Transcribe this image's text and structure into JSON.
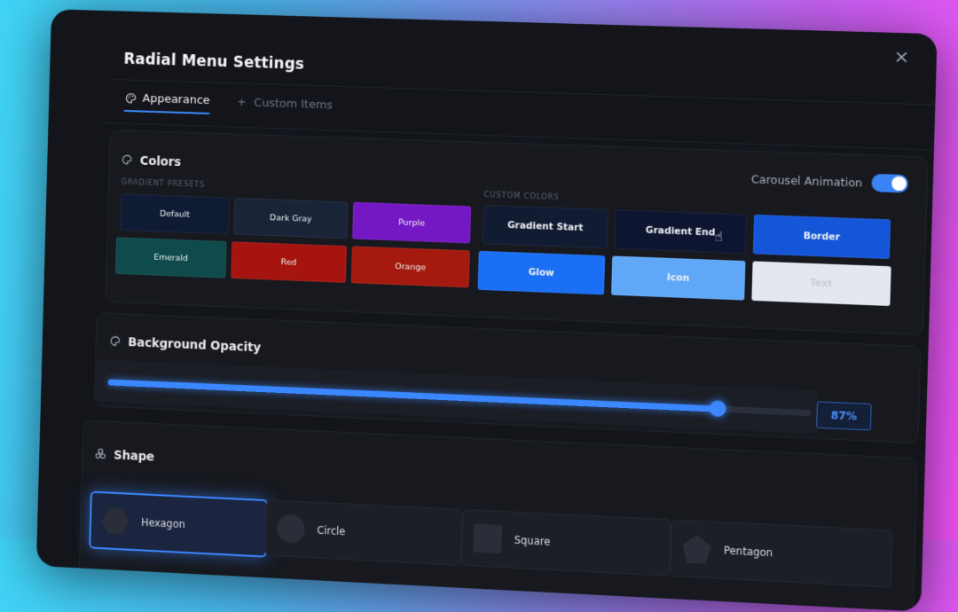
{
  "window": {
    "title": "Radial Menu Settings",
    "close_symbol": "×"
  },
  "tabs": [
    {
      "label": "Appearance",
      "icon": "palette-icon",
      "active": true
    },
    {
      "label": "Custom Items",
      "icon": "plus-icon",
      "active": false
    }
  ],
  "colors_section": {
    "title": "Colors",
    "presets_label": "GRADIENT PRESETS",
    "custom_label": "CUSTOM COLORS",
    "toggle_label": "Carousel Animation",
    "toggle_on": true,
    "presets": [
      {
        "label": "Default",
        "color": "#0f1a33"
      },
      {
        "label": "Dark Gray",
        "color": "#1a2438"
      },
      {
        "label": "Purple",
        "color": "#7418c4"
      },
      {
        "label": "Emerald",
        "color": "#0f4a4c"
      },
      {
        "label": "Red",
        "color": "#a5140f"
      },
      {
        "label": "Orange",
        "color": "#a51a0e"
      }
    ],
    "custom": [
      {
        "label": "Gradient Start",
        "color": "#111b31"
      },
      {
        "label": "Gradient End",
        "color": "#0d1530"
      },
      {
        "label": "Border",
        "color": "#1556d8"
      },
      {
        "label": "Glow",
        "color": "#1a6ff5"
      },
      {
        "label": "Icon",
        "color": "#60a8f7"
      },
      {
        "label": "Text",
        "color": "#e3e7f0"
      }
    ]
  },
  "opacity_section": {
    "title": "Background Opacity",
    "value": 87,
    "value_text": "87%"
  },
  "shape_section": {
    "title": "Shape",
    "options": [
      {
        "label": "Hexagon",
        "selected": true
      },
      {
        "label": "Circle",
        "selected": false
      },
      {
        "label": "Square",
        "selected": false
      },
      {
        "label": "Pentagon",
        "selected": false
      }
    ]
  },
  "accent_color": "#3b87ff"
}
